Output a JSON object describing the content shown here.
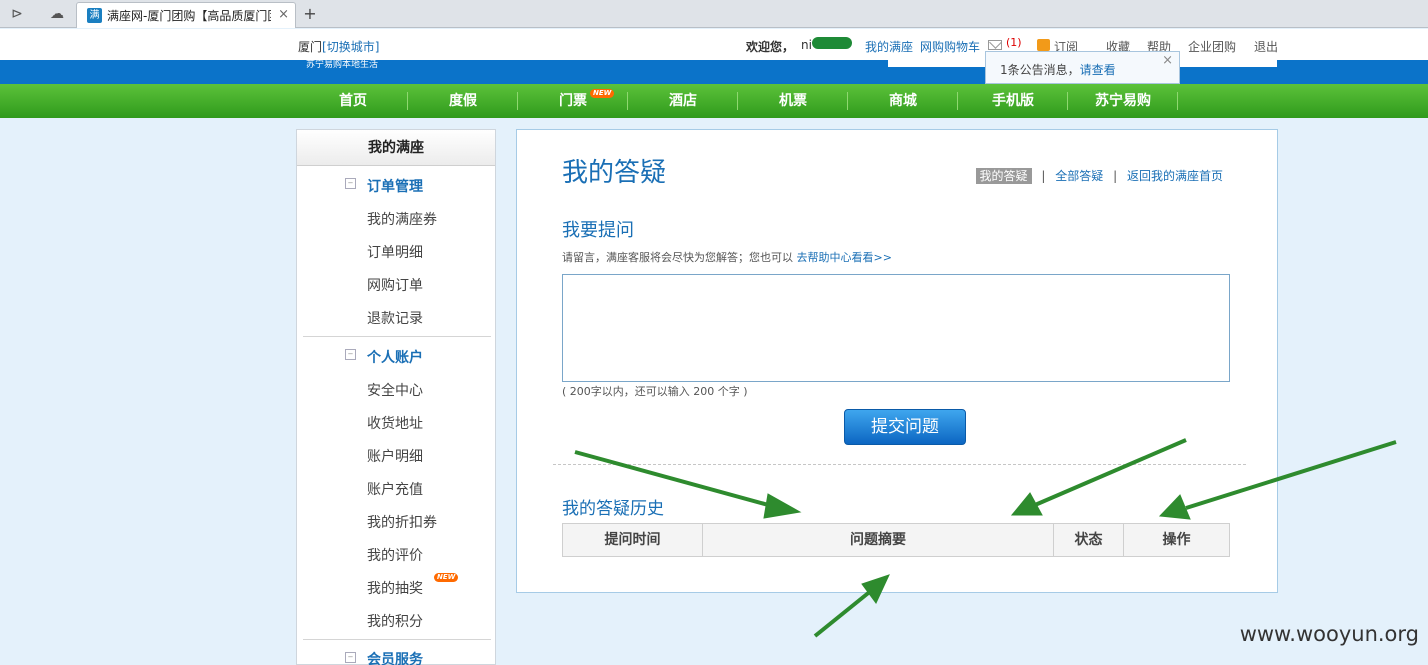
{
  "browser": {
    "tab_title": "满座网-厦门团购【高品质厦门团购",
    "favicon": "满"
  },
  "topbar": {
    "city": "厦门",
    "switch_city": "[切换城市]",
    "welcome": "欢迎您，",
    "username": "ni",
    "links": [
      "我的满座",
      "网购购物车"
    ],
    "mail_count": "(1)",
    "subscribe": "订阅",
    "right_links": [
      "收藏",
      "帮助",
      "企业团购",
      "退出"
    ]
  },
  "notice": {
    "text": "1条公告消息，",
    "link": "请查看"
  },
  "brand": {
    "subtitle": "苏宁易购本地生活"
  },
  "nav": {
    "items": [
      "首页",
      "度假",
      "门票",
      "酒店",
      "机票",
      "商城",
      "手机版",
      "苏宁易购"
    ],
    "new_badge": "NEW"
  },
  "sidebar": {
    "title": "我的满座",
    "groups": [
      {
        "label": "订单管理",
        "items": [
          "我的满座券",
          "订单明细",
          "网购订单",
          "退款记录"
        ]
      },
      {
        "label": "个人账户",
        "items": [
          "安全中心",
          "收货地址",
          "账户明细",
          "账户充值",
          "我的折扣券",
          "我的评价",
          "我的抽奖",
          "我的积分"
        ]
      },
      {
        "label": "会员服务",
        "items": []
      }
    ],
    "new_badge": "NEW"
  },
  "main": {
    "title": "我的答疑",
    "crumbs": {
      "active": "我的答疑",
      "all": "全部答疑",
      "home": "返回我的满座首页"
    },
    "ask_title": "我要提问",
    "ask_desc": "请留言，满座客服将会尽快为您解答；您也可以 ",
    "help_link": "去帮助中心看看>>",
    "question_value": "",
    "limit": "( 200字以内，还可以输入 200 个字 )",
    "submit": "提交问题",
    "history_title": "我的答疑历史",
    "table_headers": [
      "提问时间",
      "问题摘要",
      "状态",
      "操作"
    ]
  },
  "watermark": "www.wooyun.org",
  "colors": {
    "nav_green": "#3aa825",
    "brand_blue": "#0b73c9",
    "link_blue": "#1a6fb5",
    "annotation_arrow": "#2e8b2e"
  }
}
